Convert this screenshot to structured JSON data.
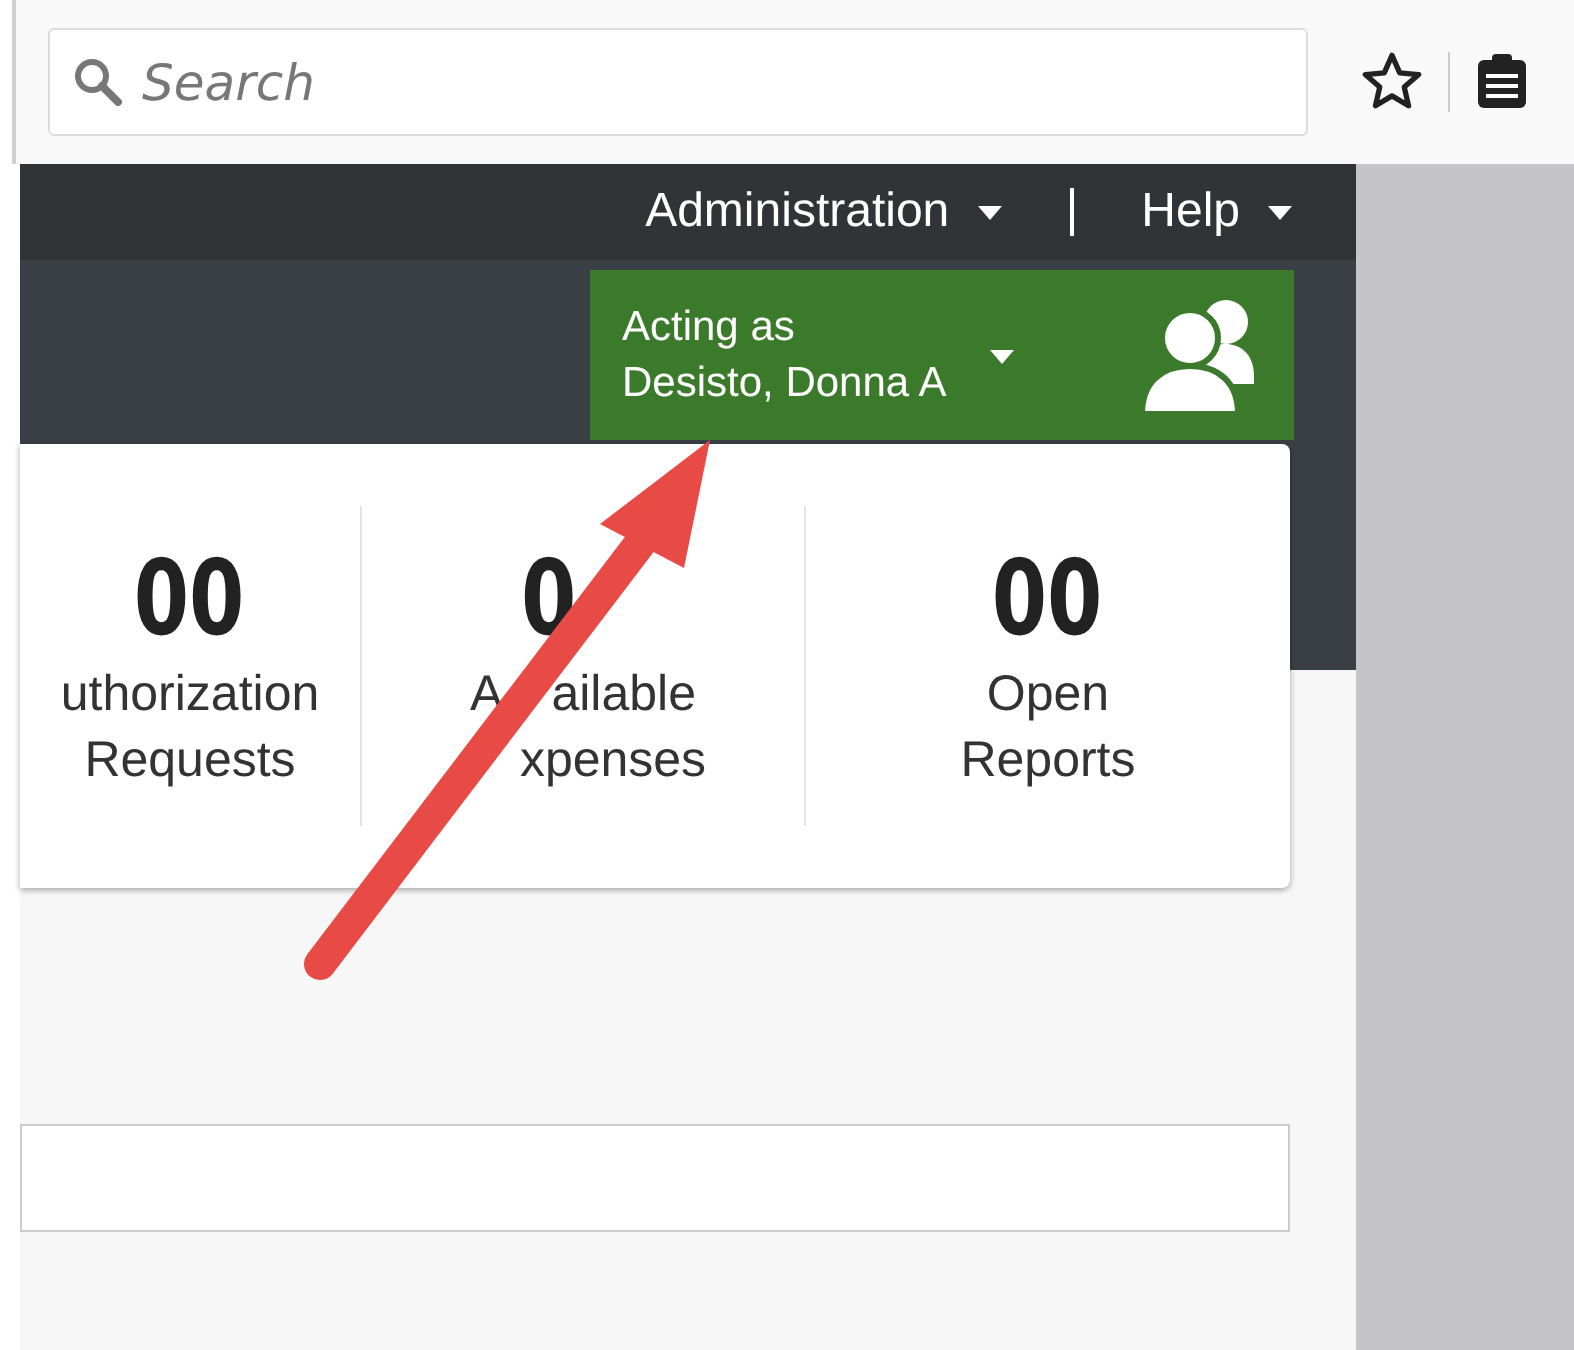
{
  "browser": {
    "search": {
      "placeholder": "Search"
    }
  },
  "nav": {
    "menus": [
      {
        "label": "Administration"
      },
      {
        "label": "Help"
      }
    ]
  },
  "acting_as": {
    "line_1": "Acting as",
    "line_2": "Desisto, Donna A"
  },
  "stats": [
    {
      "value": "00",
      "label_1": "uthorization",
      "label_2": "Requests"
    },
    {
      "value": "0",
      "label_1_start": "A",
      "label_1": "ailable",
      "label_2": "xpenses"
    },
    {
      "value": "00",
      "label_1": "Open",
      "label_2": "Reports"
    }
  ]
}
